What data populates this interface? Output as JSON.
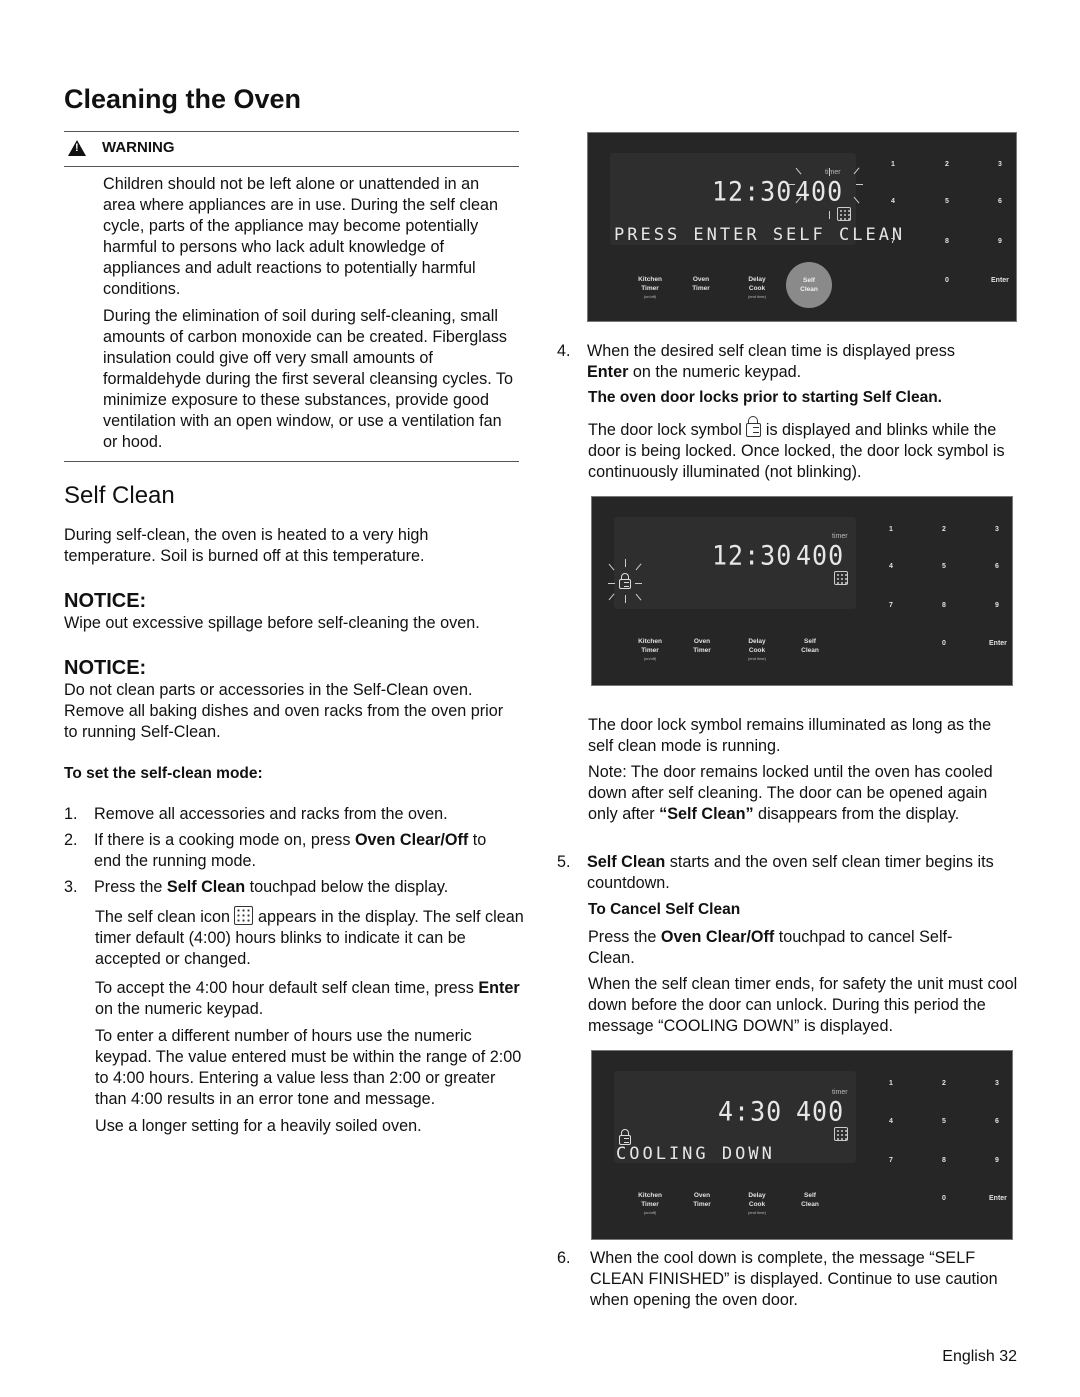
{
  "page": {
    "title": "Cleaning the Oven",
    "footer": "English 32"
  },
  "warning": {
    "label": "WARNING",
    "paragraphs": [
      "Children should not be left alone or unattended in an area where appliances are in use. During the self clean cycle, parts of the appliance may become potentially harmful to persons who lack adult knowledge of appliances and adult reactions to potentially harmful conditions.",
      "During the elimination of soil during self-cleaning, small amounts of carbon monoxide can be created. Fiberglass insulation could give off very small amounts of formaldehyde during the first several cleansing cycles. To minimize exposure to these substances, provide good ventilation with an open window, or use a ventilation fan or hood."
    ]
  },
  "self_clean": {
    "heading": "Self Clean",
    "intro": "During self-clean, the oven is heated to a very high temperature. Soil is burned off at this temperature.",
    "notices": [
      {
        "label": "NOTICE:",
        "text": "Wipe out excessive spillage before self-cleaning the oven."
      },
      {
        "label": "NOTICE:",
        "text": "Do not clean parts or accessories in the Self-Clean oven. Remove all baking dishes and oven racks from the oven prior to running Self-Clean."
      }
    ],
    "set_mode_heading": "To set the self-clean mode:",
    "steps": [
      {
        "num": "1.",
        "text": "Remove all accessories and racks from the oven."
      },
      {
        "num": "2.",
        "pre": "If there is a cooking mode on, press ",
        "bold": "Oven Clear/Off",
        "post": " to",
        "line2": "end the running mode."
      },
      {
        "num": "3.",
        "pre": "Press the ",
        "bold": "Self Clean",
        "post": " touchpad below the display."
      }
    ],
    "step3_details": {
      "icon_pre": "The self clean icon",
      "icon_post": "appears in the display. The self",
      "icon_rest": "clean timer default (4:00) hours blinks to indicate it can be accepted or changed.",
      "accept_pre": "To accept the 4:00 hour default self clean time, press",
      "accept_bold": "Enter",
      "accept_post": " on the numeric keypad.",
      "different": "To enter a different number of hours use the numeric keypad. The value entered must be within the range of 2:00 to 4:00 hours. Entering a value less than 2:00 or greater than 4:00 results in an error tone and message.",
      "longer": "Use a longer setting for a heavily soiled oven."
    },
    "step4": {
      "num": "4.",
      "line1": "When the desired self clean time is displayed press",
      "bold": "Enter",
      "post": " on the numeric keypad.",
      "lock_heading": "The oven door locks prior to starting Self Clean.",
      "lock_pre": "The door lock symbol",
      "lock_post": "is displayed and blinks while",
      "lock_rest": "the door is being locked. Once locked, the door lock symbol is continuously illuminated (not blinking).",
      "remains": "The door lock symbol remains illuminated as long as the self clean mode is running.",
      "note_pre": "Note: The door remains locked until the oven has cooled down after self cleaning. The door can be opened again only after ",
      "note_bold": "“Self Clean”",
      "note_post": " disappears from the display."
    },
    "step5": {
      "num": "5.",
      "bold": "Self Clean",
      "post": " starts and the oven self clean timer begins its countdown.",
      "cancel_heading": "To Cancel Self Clean",
      "cancel_pre": "Press the ",
      "cancel_bold": "Oven Clear/Off",
      "cancel_post": " touchpad to cancel Self-Clean.",
      "cooling": "When the self clean timer ends, for safety the unit must cool down before the door can unlock. During this period the message “COOLING DOWN” is displayed."
    },
    "step6": {
      "num": "6.",
      "text": "When the cool down is complete, the message “SELF CLEAN FINISHED” is displayed. Continue to use caution when opening the oven door."
    }
  },
  "panels": [
    {
      "clock": "12:30",
      "timer": "400",
      "timer_label": "timer",
      "message": "PRESS ENTER SELF CLEAN",
      "active_button": "Self Clean"
    },
    {
      "clock": "12:30",
      "timer": "400",
      "timer_label": "timer",
      "message": "",
      "lock": "blinking"
    },
    {
      "clock": "4:30",
      "timer": "400",
      "timer_label": "timer",
      "message": "COOLING DOWN",
      "lock": "on"
    }
  ],
  "control_pad": {
    "buttons": [
      {
        "line1": "Kitchen",
        "line2": "Timer",
        "small": "(on/off)"
      },
      {
        "line1": "Oven",
        "line2": "Timer",
        "small": ""
      },
      {
        "line1": "Delay",
        "line2": "Cook",
        "small": "(end time)"
      },
      {
        "line1": "Self",
        "line2": "Clean",
        "small": ""
      }
    ],
    "keys": [
      "1",
      "2",
      "3",
      "4",
      "5",
      "6",
      "7",
      "8",
      "9",
      "0",
      "Enter"
    ]
  }
}
